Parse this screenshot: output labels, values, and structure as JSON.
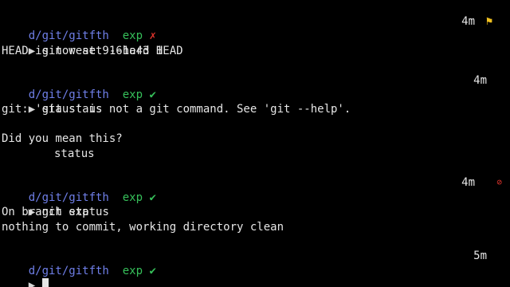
{
  "blocks": [
    {
      "path": "d/git/gitfth",
      "branch": "exp",
      "status_glyph": "✗",
      "elapsed": "4m",
      "indicator": "⚑",
      "command": "git reset --hard HEAD",
      "output": [
        "HEAD is now at 9161e43 1"
      ]
    },
    {
      "path": "d/git/gitfth",
      "branch": "exp",
      "status_glyph": "✔",
      "elapsed": "4m",
      "command": "git staus",
      "output": [
        "git: 'staus' is not a git command. See 'git --help'.",
        "",
        "Did you mean this?",
        "status"
      ]
    },
    {
      "path": "d/git/gitfth",
      "branch": "exp",
      "status_glyph": "✔",
      "elapsed": "4m",
      "indicator": "⊘",
      "command": "git status",
      "output": [
        "On branch exp",
        "nothing to commit, working directory clean"
      ]
    },
    {
      "path": "d/git/gitfth",
      "branch": "exp",
      "status_glyph": "✔",
      "elapsed": "5m",
      "command": ""
    }
  ],
  "prompt_arrow": "▶",
  "colors": {
    "path": "#6f7fe8",
    "branch": "#36c05a",
    "fail": "#e0342c",
    "flag": "#f0c020",
    "background": "#000000",
    "text": "#e6e6e6"
  }
}
